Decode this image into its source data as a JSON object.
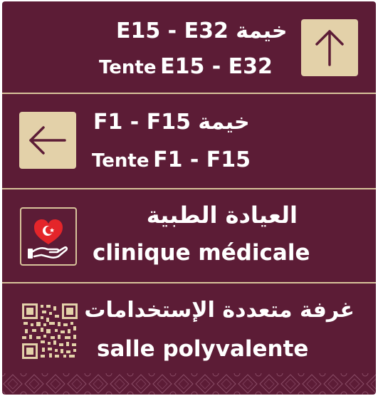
{
  "rows": [
    {
      "arabic_label": "خيمة",
      "range_line1": "E15 - E32",
      "french_label": "Tente",
      "range_line2": "E15 - E32",
      "arrow": "arrow-up-icon"
    },
    {
      "arabic_label": "خيمة",
      "range_line1": "F1 - F15",
      "french_label": "Tente",
      "range_line2": "F1 - F15",
      "arrow": "arrow-left-icon"
    },
    {
      "arabic": "العيادة الطبية",
      "french": "clinique médicale",
      "icon": "medical-heart-hand-icon"
    },
    {
      "arabic": "غرفة متعددة الإستخدامات",
      "french": "salle polyvalente",
      "icon": "qr-code-icon"
    }
  ],
  "colors": {
    "background": "#5c1c36",
    "accent": "#e3d1a9",
    "divider": "#d8c39b",
    "heart": "#e4252a",
    "text": "#ffffff"
  }
}
